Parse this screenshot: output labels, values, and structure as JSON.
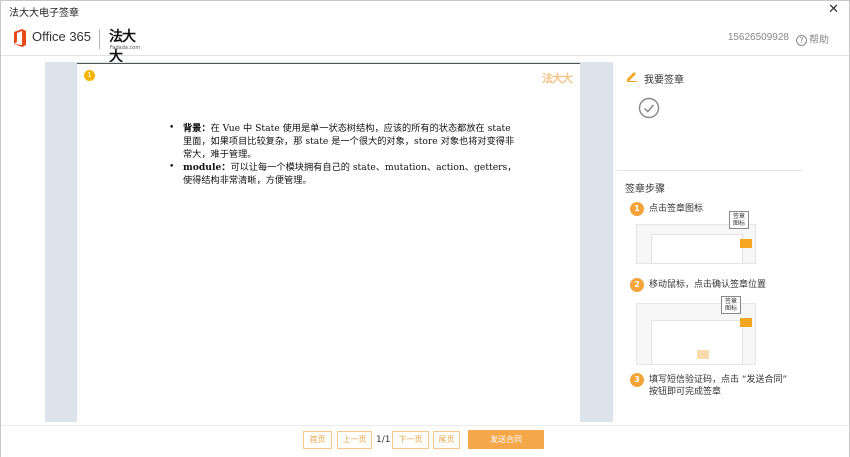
{
  "window": {
    "title": "法大大电子签章",
    "close_glyph": "✕"
  },
  "header": {
    "office_logo_text": "Office 365",
    "fdd_logo_text": "法大大",
    "fdd_logo_sub": "Fadada.com",
    "phone": "15626509928",
    "help_label": "帮助",
    "help_icon_glyph": "?"
  },
  "document": {
    "page_marker": "1",
    "watermark": "法大大",
    "bullets": [
      {
        "label": "背景：",
        "text": "在 Vue 中 State 使用是单一状态树结构，应该的所有的状态都放在 state 里面，如果项目比较复杂，那 state 是一个很大的对象，store 对象也将对变得非常大，难于管理。"
      },
      {
        "label": "module：",
        "text": "可以让每一个模块拥有自己的 state、mutation、action、getters，使得结构非常清晰，方便管理。"
      }
    ]
  },
  "side": {
    "sign_label": "我要签章",
    "steps_title": "签章步骤",
    "steps": [
      {
        "num": "1",
        "text": "点击签章图标",
        "tag": "签章\n图标"
      },
      {
        "num": "2",
        "text": "移动鼠标，点击确认签章位置",
        "tag": "签章\n图标"
      },
      {
        "num": "3",
        "text": "填写短信验证码，点击 “发送合同” 按钮即可完成签章"
      }
    ]
  },
  "pager": {
    "first": "首页",
    "prev": "上一页",
    "info": "1/1",
    "next": "下一页",
    "last": "尾页",
    "send": "发送合同"
  },
  "colors": {
    "accent": "#f5a84a",
    "office_red": "#e94b1b",
    "doc_bg": "#dde3ea"
  },
  "icons": {
    "office": "office-logo-icon",
    "pen": "pen-icon",
    "check": "check-circle-icon",
    "help": "help-icon",
    "close": "close-icon"
  }
}
